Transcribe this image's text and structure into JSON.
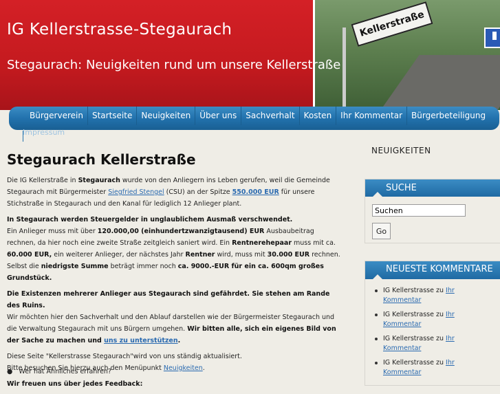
{
  "site": {
    "title": "IG Kellerstrasse-Stegaurach",
    "description": "Stegaurach: Neuigkeiten rund um unsere Kellerstraße",
    "header_sign": "Kellerstraße"
  },
  "nav": {
    "items": [
      "Bürgerverein",
      "Startseite",
      "Neuigkeiten",
      "Über uns",
      "Sachverhalt",
      "Kosten",
      "Ihr Kommentar",
      "Bürgerbeteiligung"
    ],
    "second_row": "Impressum"
  },
  "main": {
    "title": "Stegaurach Kellerstraße",
    "p1": {
      "t1": "Die IG Kellerstraße in ",
      "b1": "Stegaurach",
      "t2": " wurde von den Anliegern ins Leben gerufen, weil die Gemeinde Stegaurach mit Bürgermeister ",
      "link1": "Siegfried Stengel",
      "t3": " (CSU) an der Spitze ",
      "link2": "550.000 EUR",
      "t4": " für unsere Stichstraße in Stegaurach und den Kanal für lediglich 12 Anlieger plant."
    },
    "p2": {
      "b1": "In Stegaurach werden Steuergelder in unglaublichem Ausmaß verschwendet.",
      "t1": "Ein Anlieger muss mit über ",
      "b2": "120.000,00 (einhundertzwanzigtausend) EUR",
      "t2": " Ausbaubeitrag rechnen, da hier noch eine zweite Straße zeitgleich saniert wird. Ein ",
      "b3": "Rentnerehepaar",
      "t3": " muss mit ca. ",
      "b4": "60.000 EUR,",
      "t4": " ein weiterer Anlieger, der nächstes Jahr ",
      "b5": "Rentner",
      "t5": " wird,  muss mit ",
      "b6": "30.000 EUR",
      "t6": " rechnen.  Selbst die ",
      "b7": "niedrigste Summe",
      "t7": " beträgt immer noch ",
      "b8": "ca. 9000.-EUR für ein ca. 600qm großes Grundstück."
    },
    "p3": {
      "b1": "Die Existenzen mehrerer Anlieger aus Stegaurach sind gefährdet.  Sie stehen am Rande des Ruins.",
      "t1": "Wir möchten hier den Sachverhalt und den Ablauf darstellen wie der Bürgermeister Stegaurach und die Verwaltung Stegaurach mit uns Bürgern umgehen. ",
      "b2": "Wir bitten alle, sich ein eigenes Bild von der Sache zu machen und ",
      "link": "uns zu unterstützen",
      "b3": "."
    },
    "p4": {
      "t1": "Diese Seite \"Kellerstrasse Stegaurach\"wird von uns ständig aktualisiert.",
      "t2": "Bitte besuchen Sie hierzu auch den Menüpunkt ",
      "link": "Neuigkeiten",
      "t3": "."
    },
    "p5": "Wir freuen uns über jedes Feedback:",
    "bullet1": "Wer hat Ähnliches erfahren?"
  },
  "sidebar": {
    "news_heading": "NEUIGKEITEN",
    "search": {
      "title": "SUCHE",
      "value": "Suchen",
      "button": "Go"
    },
    "comments": {
      "title": "NEUESTE KOMMENTARE",
      "author": "IG Kellerstrasse",
      "connector": " zu ",
      "link_line1": "Ihr",
      "link_line2": "Kommentar",
      "count": 4
    }
  },
  "colors": {
    "header_red": "#c41a1f",
    "nav_blue": "#2272ad",
    "background": "#efede6",
    "link": "#2a6ab0"
  }
}
